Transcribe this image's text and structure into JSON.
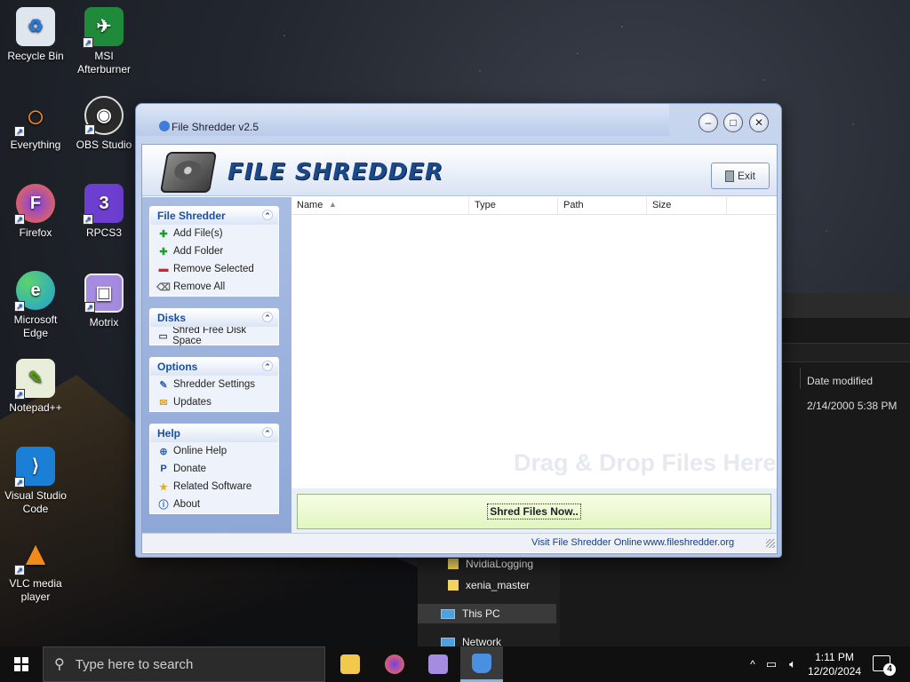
{
  "desktop": {
    "icons": [
      {
        "label": "Recycle Bin",
        "color": "#dfe6ee",
        "glyph": "♻"
      },
      {
        "label": "MSI Afterburner",
        "color": "#1e8a3a",
        "glyph": "✈"
      },
      {
        "label": "Everything",
        "color": "#ff8a1a",
        "glyph": "○"
      },
      {
        "label": "OBS Studio",
        "color": "#2a2a2a",
        "glyph": "◉"
      },
      {
        "label": "Firefox",
        "color": "#ff7139",
        "glyph": "F"
      },
      {
        "label": "RPCS3",
        "color": "#6c3fd1",
        "glyph": "3"
      },
      {
        "label": "Microsoft Edge",
        "color": "#1fa0d8",
        "glyph": "e"
      },
      {
        "label": "Motrix",
        "color": "#a58ce0",
        "glyph": "▣"
      },
      {
        "label": "Notepad++",
        "color": "#8fd14f",
        "glyph": "✎"
      },
      {
        "label": "Visual Studio Code",
        "color": "#1b7fd6",
        "glyph": "⟩"
      },
      {
        "label": "VLC media player",
        "color": "#f08a1a",
        "glyph": "▲"
      }
    ]
  },
  "explorer": {
    "column_date_modified": "Date modified",
    "date_value": "2/14/2000 5:38 PM",
    "nav": [
      "NvidiaLogging",
      "xenia_master",
      "This PC",
      "Network"
    ]
  },
  "app": {
    "title": "File Shredder v2.5",
    "logo_text": "FILE SHREDDER",
    "exit_label": "Exit",
    "panels": {
      "file_shredder": {
        "title": "File Shredder",
        "items": [
          "Add File(s)",
          "Add Folder",
          "Remove Selected",
          "Remove All"
        ]
      },
      "disks": {
        "title": "Disks",
        "items": [
          "Shred Free Disk Space"
        ]
      },
      "options": {
        "title": "Options",
        "items": [
          "Shredder Settings",
          "Updates"
        ]
      },
      "help": {
        "title": "Help",
        "items": [
          "Online Help",
          "Donate",
          "Related Software",
          "About"
        ]
      }
    },
    "columns": [
      "Name",
      "Type",
      "Path",
      "Size"
    ],
    "drag_hint": "Drag & Drop Files Here",
    "shred_button": "Shred Files Now..",
    "status_visit": "Visit File Shredder Online",
    "status_url": "www.fileshredder.org"
  },
  "taskbar": {
    "search_placeholder": "Type here to search",
    "time": "1:11 PM",
    "date": "12/20/2024",
    "notification_count": "4"
  }
}
